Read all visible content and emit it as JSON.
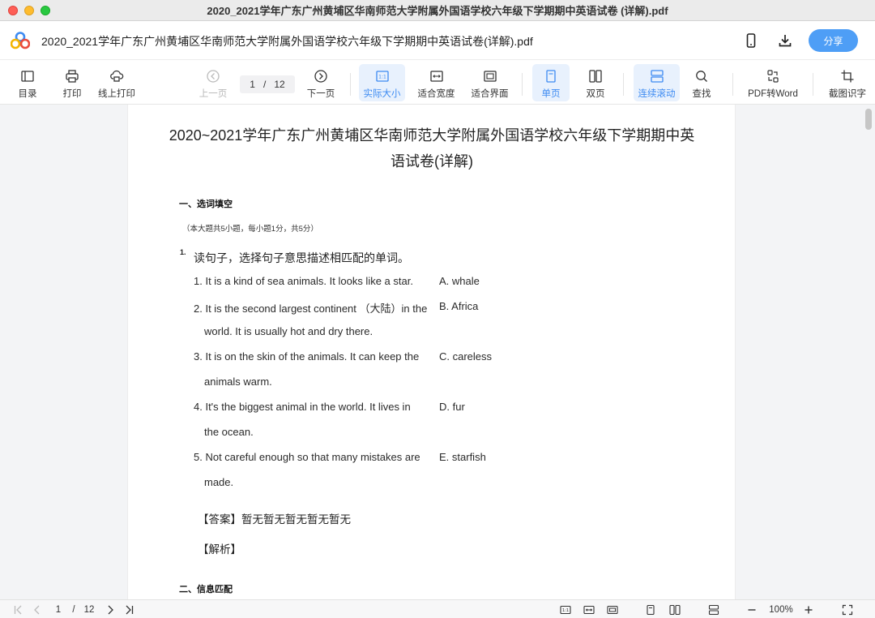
{
  "window": {
    "title": "2020_2021学年广东广州黄埔区华南师范大学附属外国语学校六年级下学期期中英语试卷 (详解).pdf"
  },
  "header": {
    "file_title": "2020_2021学年广东广州黄埔区华南师范大学附属外国语学校六年级下学期期中英语试卷(详解).pdf",
    "share_label": "分享",
    "accent_color": "#4e9ef6"
  },
  "toolbar": {
    "toc": "目录",
    "print": "打印",
    "online_print": "线上打印",
    "prev_page": "上一页",
    "current_page": "1",
    "separator": "/",
    "total_pages": "12",
    "next_page": "下一页",
    "actual_size": "实际大小",
    "fit_width": "适合宽度",
    "fit_screen": "适合界面",
    "single_page": "单页",
    "double_page": "双页",
    "continuous_scroll": "连续滚动",
    "find": "查找",
    "pdf_to_word": "PDF转Word",
    "screenshot_ocr": "截图识字"
  },
  "document": {
    "title_line1": "2020~2021学年广东广州黄埔区华南师范大学附属外国语学校六年级下学期期中英",
    "title_line2": "语试卷(详解)",
    "section1_heading": "一、选词填空",
    "section1_note": "（本大题共5小题，每小题1分，共5分）",
    "q1_number": "1.",
    "q1_prompt": "读句子，选择句子意思描述相匹配的单词。",
    "lines": [
      "1. It is a kind of sea animals. It looks like a star.",
      "2. It is the second largest continent （大陆）in the",
      "world. It is usually hot and dry there.",
      "3. It is on the skin of the animals. It can keep the",
      "animals warm.",
      "4. It's the biggest animal in the world. It lives in",
      "the ocean.",
      "5. Not careful enough so that many mistakes are",
      "made."
    ],
    "options": [
      "A. whale",
      "B. Africa",
      "C. careless",
      "D. fur",
      "E. starfish"
    ],
    "answer": "【答案】暂无暂无暂无暂无暂无",
    "analysis": "【解析】",
    "section2_heading": "二、信息匹配"
  },
  "statusbar": {
    "current_page": "1",
    "separator": "/",
    "total_pages": "12",
    "zoom": "100%"
  }
}
